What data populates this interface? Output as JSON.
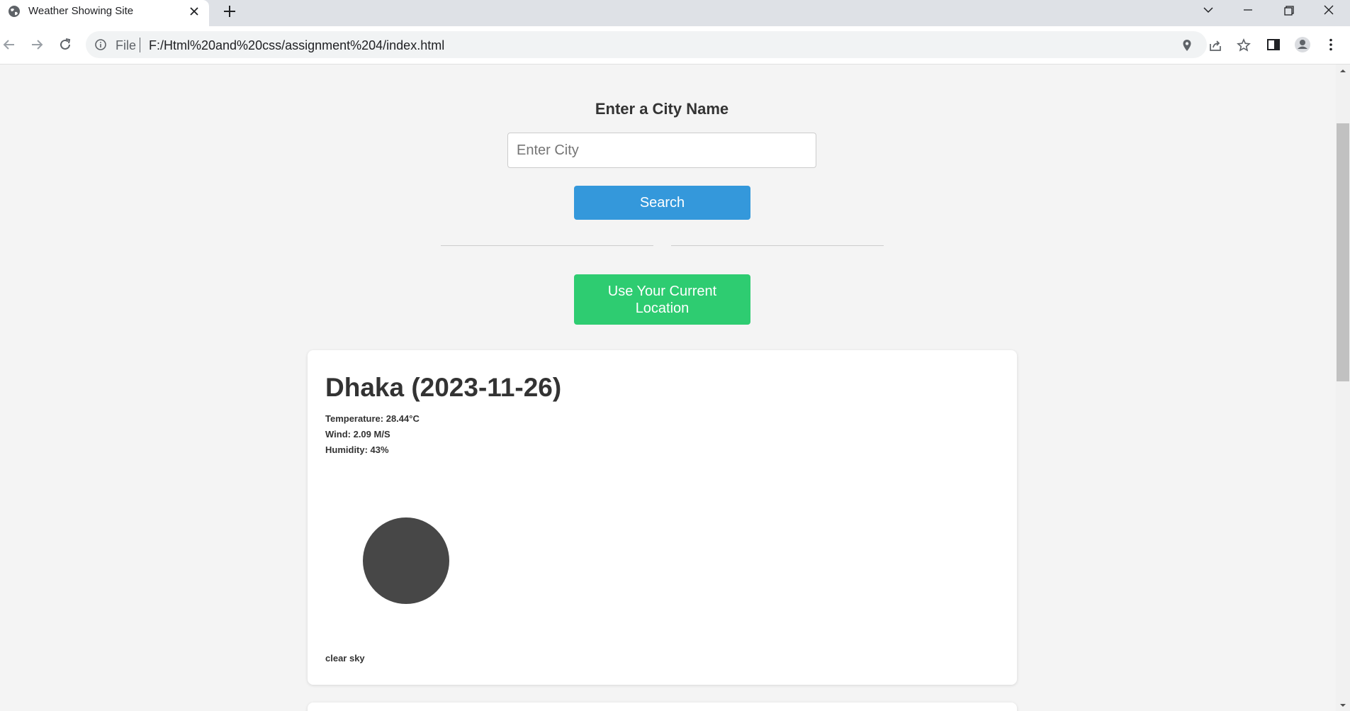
{
  "browser": {
    "tab_title": "Weather Showing Site",
    "scheme_label": "File",
    "url": "F:/Html%20and%20css/assignment%204/index.html"
  },
  "page": {
    "heading": "Enter a City Name",
    "search_placeholder": "Enter City",
    "search_button": "Search",
    "location_button": "Use Your Current Location"
  },
  "weather": {
    "city_date": "Dhaka (2023-11-26)",
    "temperature": "Temperature: 28.44°C",
    "wind": "Wind: 2.09 M/S",
    "humidity": "Humidity: 43%",
    "icon": "clear-sky-icon",
    "description": "clear sky"
  },
  "colors": {
    "search_button": "#3498db",
    "location_button": "#2ecc71",
    "weather_icon": "#474747"
  }
}
